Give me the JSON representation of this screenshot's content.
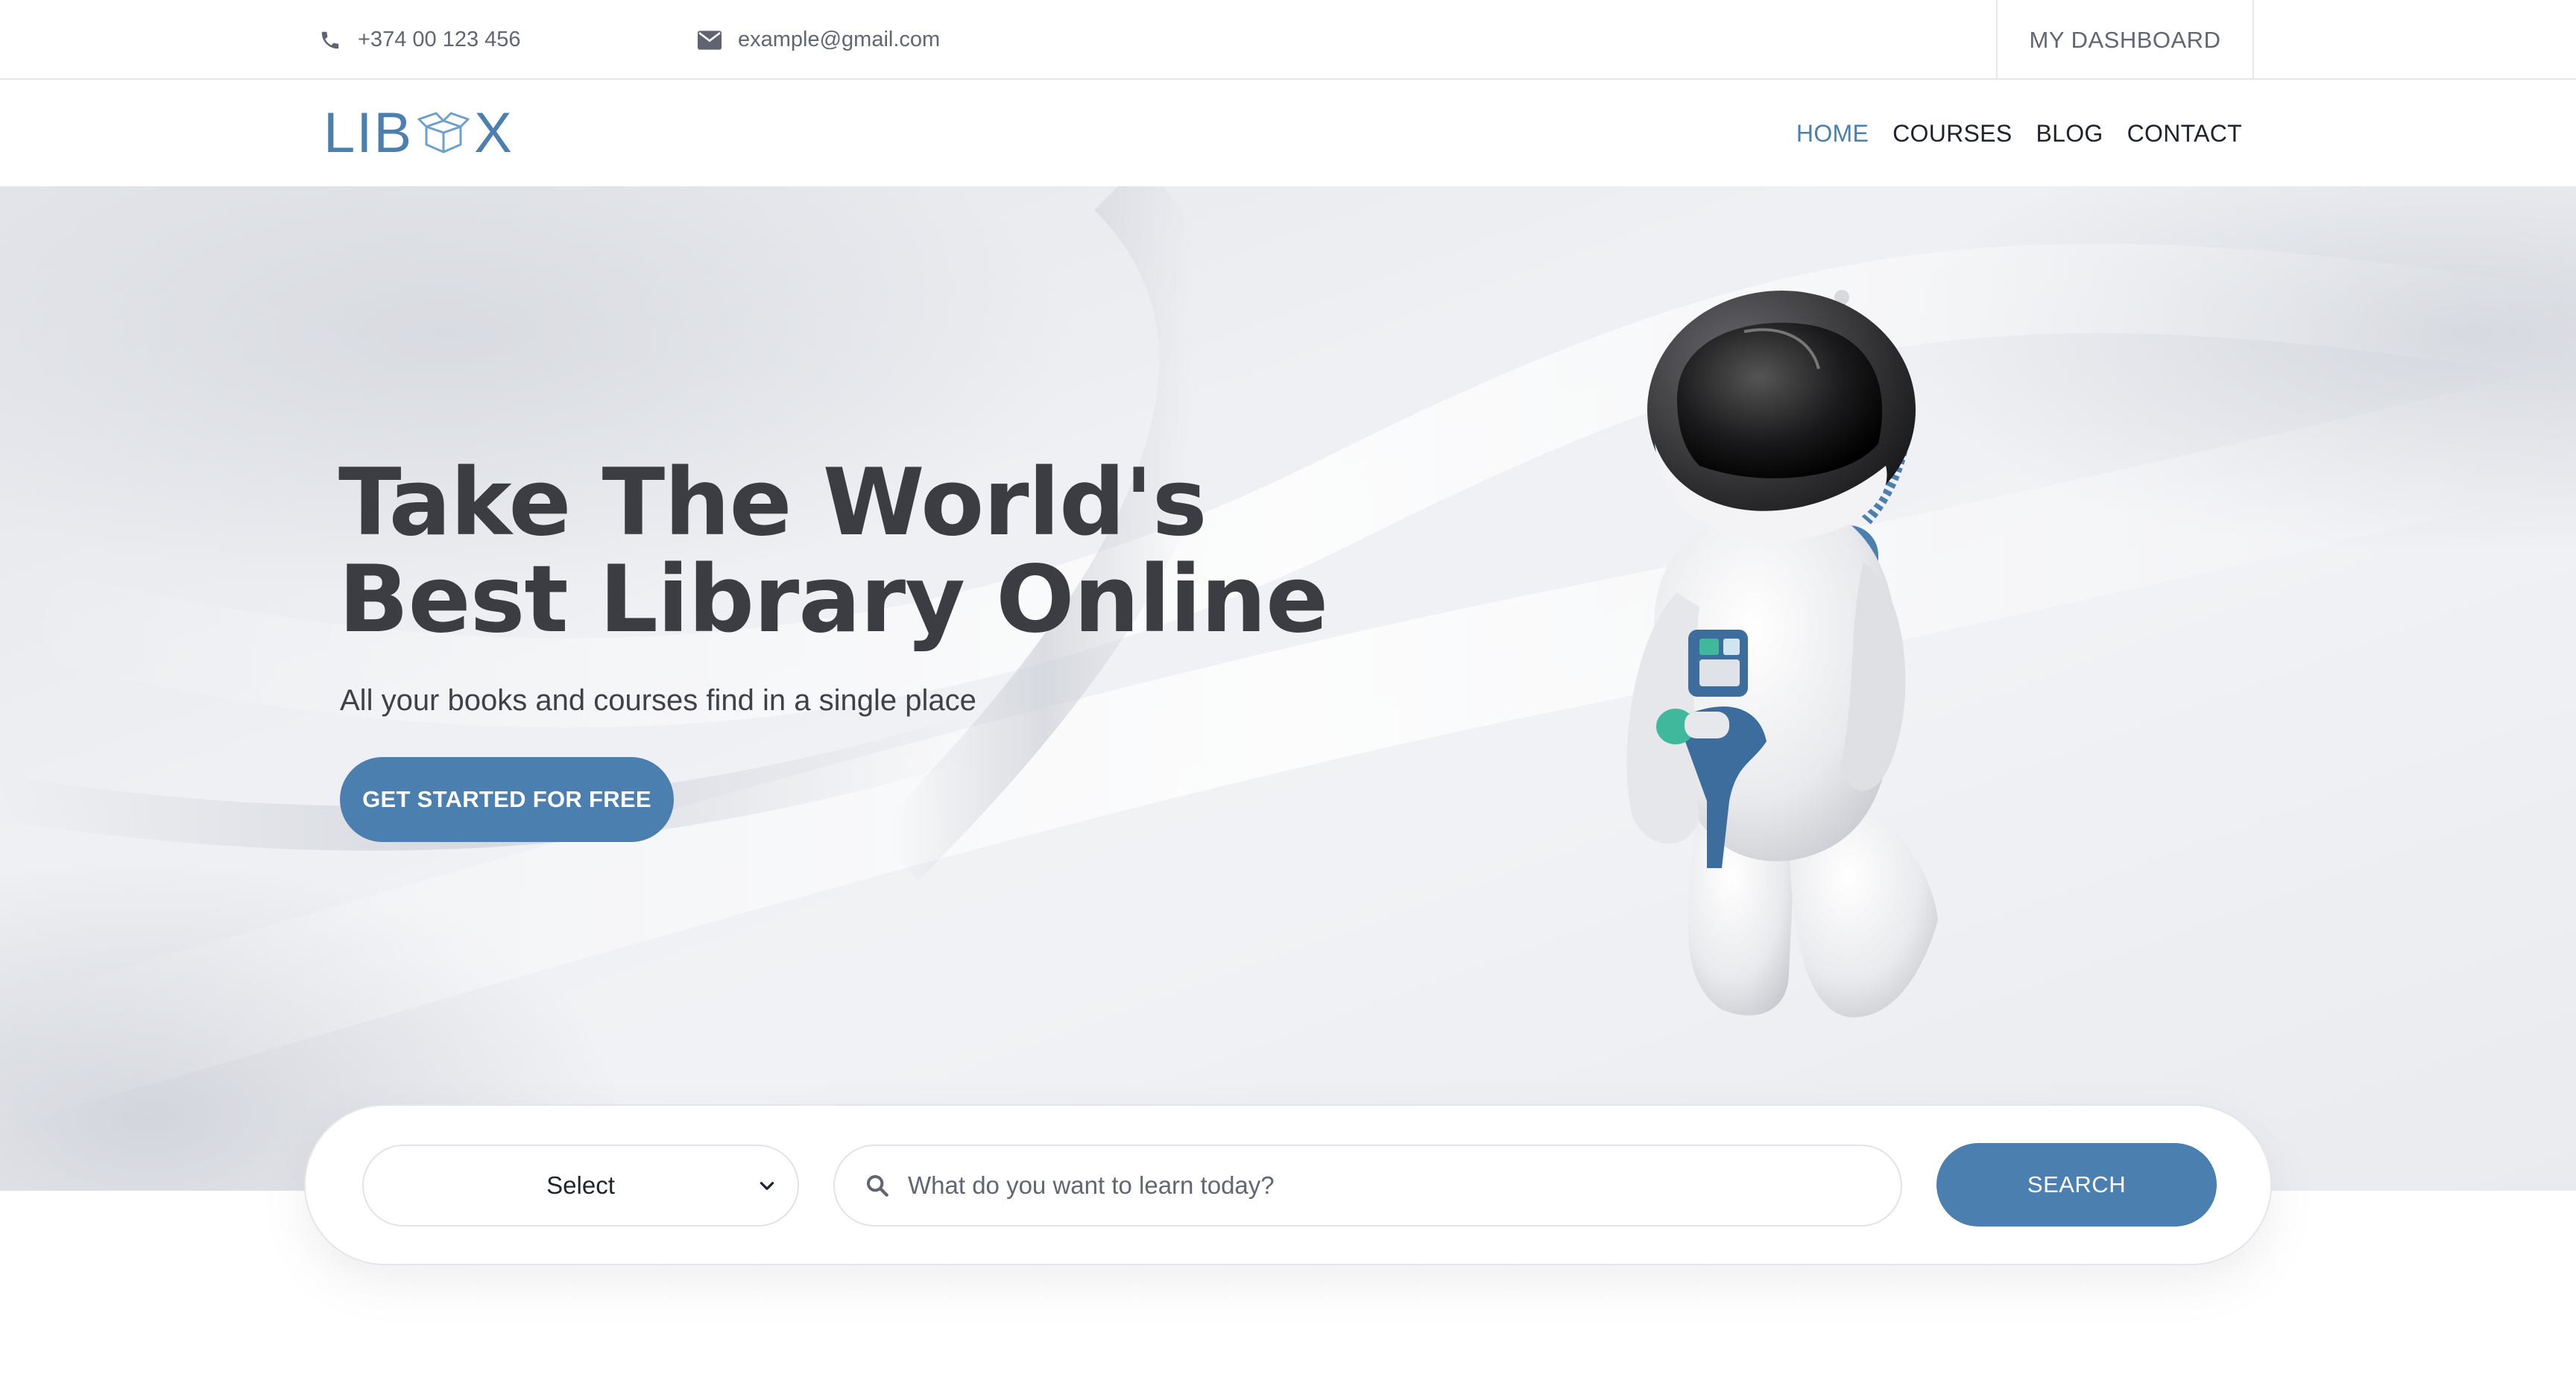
{
  "topbar": {
    "phone": "+374 00 123 456",
    "email": "example@gmail.com",
    "dashboard_label": "MY DASHBOARD"
  },
  "logo": {
    "text_left": "LIB",
    "text_right": "X"
  },
  "nav": {
    "items": [
      {
        "label": "HOME",
        "active": true
      },
      {
        "label": "COURSES",
        "active": false
      },
      {
        "label": "BLOG",
        "active": false
      },
      {
        "label": "CONTACT",
        "active": false
      }
    ]
  },
  "hero": {
    "title_line1": "Take The World's",
    "title_line2": "Best Library Online",
    "subtitle": "All your books and courses find in a single place",
    "cta_label": "GET STARTED FOR FREE"
  },
  "search": {
    "select_value": "Select",
    "placeholder": "What do you want to learn today?",
    "button_label": "SEARCH"
  },
  "colors": {
    "accent": "#4b7fb0",
    "heading": "#3c3d42",
    "muted": "#606672"
  },
  "icons": {
    "phone": "phone-icon",
    "email": "envelope-icon",
    "logo_box": "open-box-icon",
    "select_chevron": "chevron-down-icon",
    "search": "search-icon"
  }
}
